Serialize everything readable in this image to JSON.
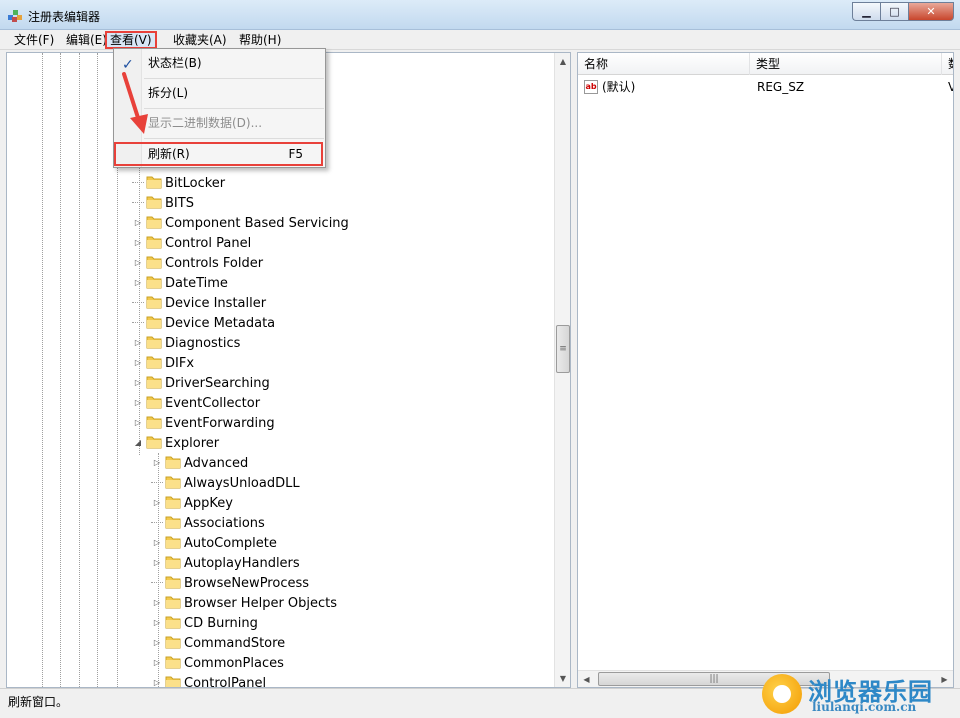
{
  "window": {
    "title": "注册表编辑器",
    "buttons": {
      "minimize": "▁",
      "maximize": "□",
      "close": "✕"
    }
  },
  "menubar": {
    "items": [
      {
        "label": "文件(F)"
      },
      {
        "label": "编辑(E)"
      },
      {
        "label": "查看(V)",
        "active": true
      },
      {
        "label": "收藏夹(A)"
      },
      {
        "label": "帮助(H)"
      }
    ]
  },
  "view_menu": {
    "items": [
      {
        "label": "状态栏(B)",
        "checked": true,
        "check_glyph": "✓"
      },
      {
        "label": "拆分(L)"
      },
      {
        "label": "显示二进制数据(D)...",
        "disabled": true
      },
      {
        "label": "刷新(R)",
        "shortcut": "F5",
        "highlighted": true
      }
    ]
  },
  "tree": {
    "items": [
      {
        "label": "BitLocker",
        "expander": "",
        "level": 0
      },
      {
        "label": "BITS",
        "expander": "",
        "level": 0
      },
      {
        "label": "Component Based Servicing",
        "expander": "▷",
        "level": 0
      },
      {
        "label": "Control Panel",
        "expander": "▷",
        "level": 0
      },
      {
        "label": "Controls Folder",
        "expander": "▷",
        "level": 0
      },
      {
        "label": "DateTime",
        "expander": "▷",
        "level": 0
      },
      {
        "label": "Device Installer",
        "expander": "",
        "level": 0
      },
      {
        "label": "Device Metadata",
        "expander": "",
        "level": 0
      },
      {
        "label": "Diagnostics",
        "expander": "▷",
        "level": 0
      },
      {
        "label": "DIFx",
        "expander": "▷",
        "level": 0
      },
      {
        "label": "DriverSearching",
        "expander": "▷",
        "level": 0
      },
      {
        "label": "EventCollector",
        "expander": "▷",
        "level": 0
      },
      {
        "label": "EventForwarding",
        "expander": "▷",
        "level": 0
      },
      {
        "label": "Explorer",
        "expander": "◢",
        "level": 0
      },
      {
        "label": "Advanced",
        "expander": "▷",
        "level": 1
      },
      {
        "label": "AlwaysUnloadDLL",
        "expander": "",
        "level": 1
      },
      {
        "label": "AppKey",
        "expander": "▷",
        "level": 1
      },
      {
        "label": "Associations",
        "expander": "",
        "level": 1
      },
      {
        "label": "AutoComplete",
        "expander": "▷",
        "level": 1
      },
      {
        "label": "AutoplayHandlers",
        "expander": "▷",
        "level": 1
      },
      {
        "label": "BrowseNewProcess",
        "expander": "",
        "level": 1
      },
      {
        "label": "Browser Helper Objects",
        "expander": "▷",
        "level": 1
      },
      {
        "label": "CD Burning",
        "expander": "▷",
        "level": 1
      },
      {
        "label": "CommandStore",
        "expander": "▷",
        "level": 1
      },
      {
        "label": "CommonPlaces",
        "expander": "▷",
        "level": 1
      },
      {
        "label": "ControlPanel",
        "expander": "▷",
        "level": 1
      }
    ]
  },
  "list": {
    "columns": [
      {
        "label": "名称"
      },
      {
        "label": "类型"
      },
      {
        "label": "数"
      }
    ],
    "rows": [
      {
        "name": "(默认)",
        "type": "REG_SZ",
        "data": "V"
      }
    ],
    "icon_label": "ab"
  },
  "scroll": {
    "up": "▲",
    "down": "▼",
    "left": "◀",
    "right": "▶",
    "grip_v": "≡",
    "grip_h": "|||"
  },
  "status": {
    "text": "刷新窗口。"
  },
  "watermark": {
    "main": "浏览器乐园",
    "sub": "liulanqi.com.cn"
  },
  "colors": {
    "annotation_red": "#e8413a",
    "folder_yellow": "#f2c94c"
  }
}
